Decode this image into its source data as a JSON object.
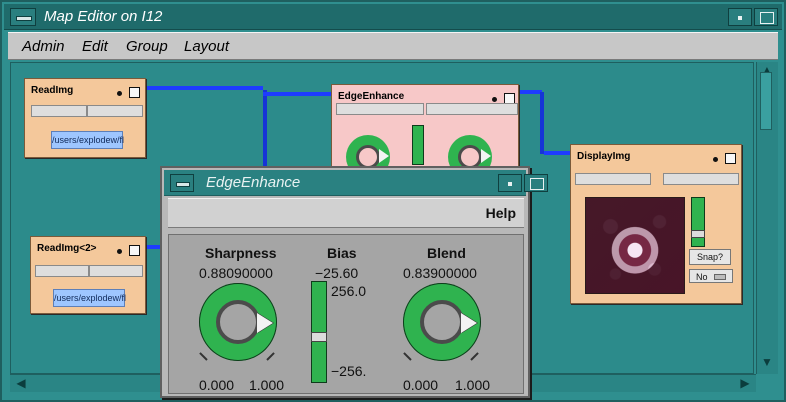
{
  "window": {
    "title": "Map Editor on I12"
  },
  "menu": [
    "Admin",
    "Edit",
    "Group",
    "Layout"
  ],
  "modules": {
    "readimg": {
      "title": "ReadImg",
      "path": "/users/explodew/fl"
    },
    "readimg2": {
      "title": "ReadImg<2>",
      "path": "/users/explodew/fl"
    },
    "edgeenhance": {
      "title": "EdgeEnhance"
    },
    "displayimg": {
      "title": "DisplayImg",
      "snap_label": "Snap?",
      "no_label": "No"
    }
  },
  "dialog": {
    "title": "EdgeEnhance",
    "help": "Help",
    "sharpness": {
      "label": "Sharpness",
      "value": "0.88090000",
      "min": "0.000",
      "max": "1.000"
    },
    "bias": {
      "label": "Bias",
      "value": "−25.60",
      "top": "256.0",
      "bottom": "−256."
    },
    "blend": {
      "label": "Blend",
      "value": "0.83900000",
      "min": "0.000",
      "max": "1.000"
    }
  },
  "colors": {
    "desktop": "#2e8b8b",
    "wire": "#1e3cff",
    "module_orange": "#f4c89b",
    "module_pink": "#f7c8c8",
    "dial_green": "#2fb34f"
  }
}
